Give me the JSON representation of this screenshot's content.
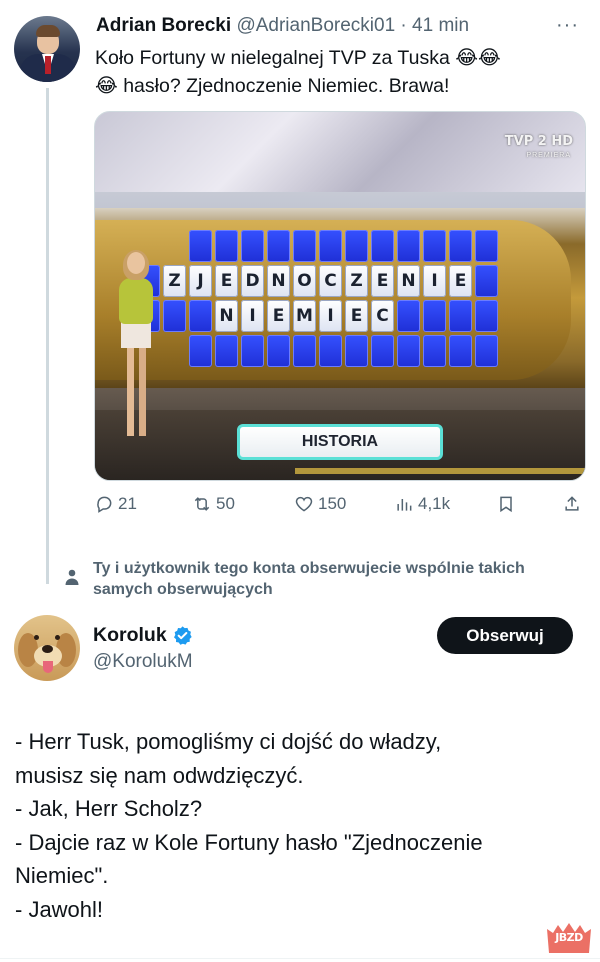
{
  "tweet1": {
    "author_name": "Adrian Borecki",
    "author_handle": "@AdrianBorecki01",
    "separator": "·",
    "time": "41 min",
    "more": "···",
    "text_line1": "Koło Fortuny w nielegalnej TVP za Tuska 😂😂",
    "text_line2": "😂 hasło? Zjednoczenie Niemiec. Brawa!",
    "media": {
      "channel_logo": "TVP 2 HD",
      "channel_sub": "PREMIERA",
      "puzzle_word1": "ZJEDNOCZENIE",
      "puzzle_word2": "NIEMIEC",
      "category": "HISTORIA"
    },
    "stats": {
      "replies": "21",
      "reposts": "50",
      "likes": "150",
      "views": "4,1k"
    },
    "icons": [
      "reply-icon",
      "repost-icon",
      "like-icon",
      "views-icon",
      "bookmark-icon",
      "share-icon"
    ]
  },
  "follow_notice": {
    "text": "Ty i użytkownik tego konta obserwujecie wspólnie takich samych obserwujących",
    "icon": "person-icon"
  },
  "tweet2": {
    "author_name": "Koroluk",
    "author_handle": "@KorolukM",
    "verified_icon": "verified-badge-icon",
    "follow_label": "Obserwuj",
    "lines": [
      "- Herr Tusk, pomogliśmy ci dojść do władzy,",
      "musisz się nam odwdzięczyć.",
      "- Jak, Herr Scholz?",
      "- Dajcie raz w Kole Fortuny hasło \"Zjednoczenie",
      "Niemiec\".",
      "- Jawohl!"
    ]
  },
  "watermark": "JBZD",
  "colors": {
    "text_primary": "#0f1419",
    "text_secondary": "#536471",
    "verified_blue": "#1d9bf0",
    "button_dark": "#0f1419",
    "watermark_red": "#e8574a"
  }
}
